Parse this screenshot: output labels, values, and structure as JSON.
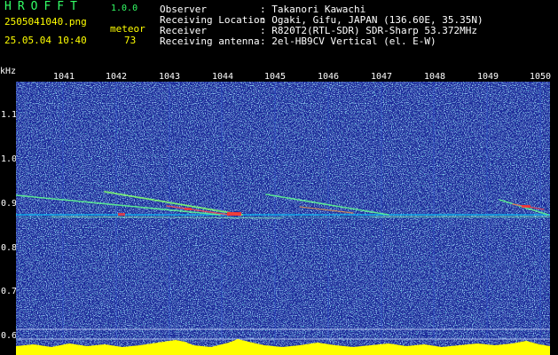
{
  "app": {
    "title": "HROFFT",
    "version": "1.0.0"
  },
  "file": {
    "name": "2505041040.png",
    "datetime": "25.05.04 10:40"
  },
  "meteor": {
    "label": "meteor",
    "count": "73"
  },
  "info": [
    {
      "label": "Observer",
      "value": ": Takanori Kawachi"
    },
    {
      "label": "Receiving Location",
      "value": ": Ogaki, Gifu, JAPAN (136.60E, 35.35N)"
    },
    {
      "label": "Receiver",
      "value": ": R820T2(RTL-SDR) SDR-Sharp 53.372MHz"
    },
    {
      "label": "Receiving antenna",
      "value": ": 2el-HB9CV Vertical (el. E-W)"
    }
  ],
  "axes": {
    "unit": "kHz",
    "time_ticks": [
      "1041",
      "1042",
      "1043",
      "1044",
      "1045",
      "1046",
      "1047",
      "1048",
      "1049",
      "1050"
    ],
    "freq_ticks": [
      "1.1",
      "1.0",
      "0.9",
      "0.8",
      "0.7",
      "0.6"
    ]
  },
  "colors": {
    "background": "#1a2a9a",
    "noise_bright": "#6aa0ff",
    "trail": "#60ff90",
    "hot": "#ff5050",
    "level_bar": "#ffff00",
    "baseline": "#00c8ff"
  }
}
